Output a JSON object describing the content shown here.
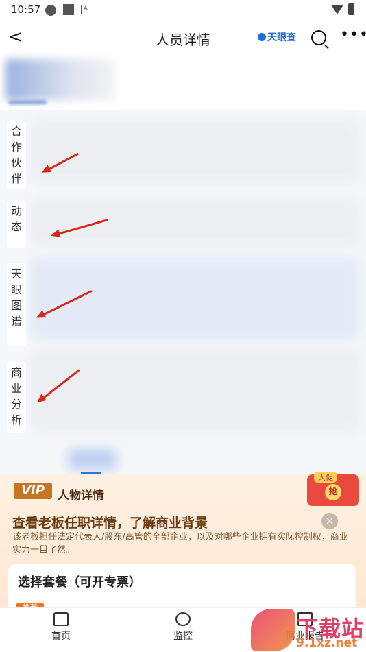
{
  "status_bar": {
    "time": "10:57"
  },
  "header": {
    "back_glyph": "<",
    "title": "人员详情",
    "brand": "天眼查",
    "more_glyph": "•••"
  },
  "side_tabs": [
    {
      "label": "合\n作\n伙\n伴"
    },
    {
      "label": "动\n态"
    },
    {
      "label": "天\n眼\n图\n谱"
    },
    {
      "label": "商\n业\n分\n析"
    }
  ],
  "vip_panel": {
    "logo": "VIP",
    "subtitle": "人物详情",
    "headline": "查看老板任职详情，了解商业背景",
    "description": "该老板担任法定代表人/股东/高管的全部企业，以及对哪些企业拥有实际控制权，商业实力一目了然。",
    "close_glyph": "×",
    "gift_grab": "抢",
    "gift_sale": "大促",
    "plan_title": "选择套餐（可开专票）",
    "plan_tag": "推荐"
  },
  "tabbar": [
    {
      "label": "首页",
      "icon": "home-icon"
    },
    {
      "label": "监控",
      "icon": "camera-icon"
    },
    {
      "label": "商业报告",
      "icon": "report-icon"
    }
  ],
  "watermark": {
    "text": "下载站",
    "url": "9.1xz.net"
  },
  "colors": {
    "arrow": "#d42a1a",
    "brand": "#1f6fd6",
    "vip_accent": "#c87521"
  }
}
